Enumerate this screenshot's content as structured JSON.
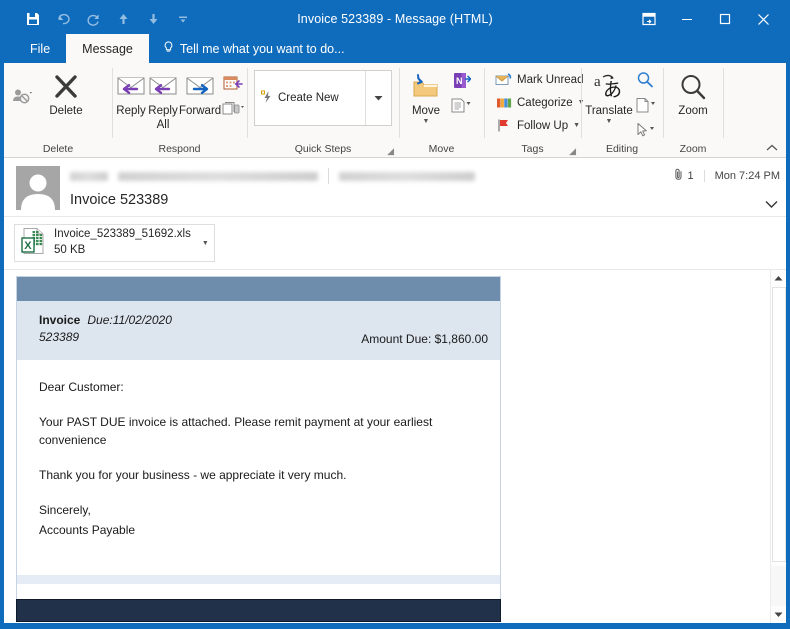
{
  "window": {
    "title": "Invoice 523389 - Message (HTML)",
    "quick_access": [
      {
        "name": "save-icon",
        "label": "Save"
      },
      {
        "name": "undo-icon",
        "label": "Undo"
      },
      {
        "name": "redo-icon",
        "label": "Redo"
      },
      {
        "name": "previous-item-icon",
        "label": "Previous Item"
      },
      {
        "name": "next-item-icon",
        "label": "Next Item"
      },
      {
        "name": "customize-quick-access-toolbar-icon",
        "label": "Customize Quick Access Toolbar"
      }
    ],
    "controls": [
      {
        "name": "ribbon-display-options",
        "label": "Ribbon Display Options"
      },
      {
        "name": "minimize",
        "label": "Minimize"
      },
      {
        "name": "maximize",
        "label": "Maximize"
      },
      {
        "name": "close",
        "label": "Close"
      }
    ],
    "accent_color": "#0f6cbd"
  },
  "tabs": {
    "file": "File",
    "message": "Message",
    "tellme": "Tell me what you want to do..."
  },
  "ribbon": {
    "collapse_label": "^",
    "groups": [
      {
        "name": "delete",
        "label": "Delete",
        "buttons": [
          {
            "name": "ignore-button",
            "label": "Ignore"
          },
          {
            "name": "delete-button",
            "label": "Delete"
          }
        ]
      },
      {
        "name": "respond",
        "label": "Respond",
        "buttons": [
          {
            "name": "reply-button",
            "label": "Reply"
          },
          {
            "name": "reply-all-button",
            "label": "Reply\nAll"
          },
          {
            "name": "forward-button",
            "label": "Forward"
          },
          {
            "name": "meeting-button",
            "label": "Meeting"
          },
          {
            "name": "more-respond-button",
            "label": "More"
          }
        ],
        "reply_label": "Reply",
        "reply_all_label_1": "Reply",
        "reply_all_label_2": "All",
        "forward_label": "Forward"
      },
      {
        "name": "quick-steps",
        "label": "Quick Steps",
        "create_new_label": "Create New",
        "dialog_launcher": true
      },
      {
        "name": "move",
        "label": "Move",
        "move_label": "Move",
        "onenote_label": "OneNote",
        "rules_label": "Rules"
      },
      {
        "name": "tags",
        "label": "Tags",
        "items": [
          {
            "name": "mark-unread-button",
            "label": "Mark Unread"
          },
          {
            "name": "categorize-button",
            "label": "Categorize"
          },
          {
            "name": "follow-up-button",
            "label": "Follow Up"
          }
        ],
        "dialog_launcher": true
      },
      {
        "name": "editing",
        "label": "Editing",
        "translate_label": "Translate",
        "find_label": "Find",
        "select_label": "Select"
      },
      {
        "name": "zoom",
        "label": "Zoom",
        "zoom_label": "Zoom"
      }
    ]
  },
  "message": {
    "sender_redacted": true,
    "recipient_redacted": true,
    "subject": "Invoice 523389",
    "attachment_count": "1",
    "received": "Mon 7:24 PM",
    "expand_label": "v",
    "attachment": {
      "name": "Invoice_523389_51692.xls",
      "size": "50 KB",
      "type": "excel-file"
    }
  },
  "invoice": {
    "label_invoice": "Invoice",
    "number": "523389",
    "due_label": "Due:11/02/2020",
    "amount_due": "Amount Due: $1,860.00",
    "greeting": "Dear Customer:",
    "paragraph_1": "Your PAST DUE invoice is attached. Please remit payment at your earliest convenience",
    "paragraph_2": "Thank you for your business - we appreciate it very much.",
    "closing": "Sincerely,",
    "signature": "Accounts Payable",
    "header_color": "#6e8cab",
    "info_band_color": "#dde5ef",
    "footer_color": "#22314a"
  }
}
